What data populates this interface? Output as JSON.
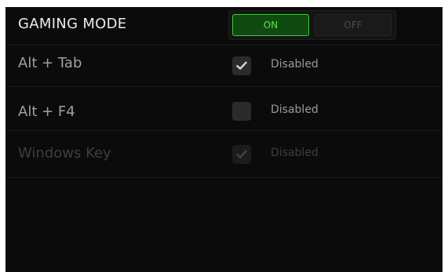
{
  "panel": {
    "title": "GAMING MODE",
    "toggle": {
      "on_label": "ON",
      "off_label": "OFF",
      "selected": "ON"
    }
  },
  "rows": [
    {
      "label": "Alt + Tab",
      "checked": true,
      "status": "Disabled",
      "enabled": true
    },
    {
      "label": "Alt + F4",
      "checked": false,
      "status": "Disabled",
      "enabled": true
    },
    {
      "label": "Windows Key",
      "checked": true,
      "status": "Disabled",
      "enabled": false
    }
  ],
  "colors": {
    "accent_green": "#45c438",
    "on_text": "#5ae14b",
    "background": "#0b0b0b"
  },
  "icons": {
    "checkbox_mark": "checkmark-icon"
  }
}
